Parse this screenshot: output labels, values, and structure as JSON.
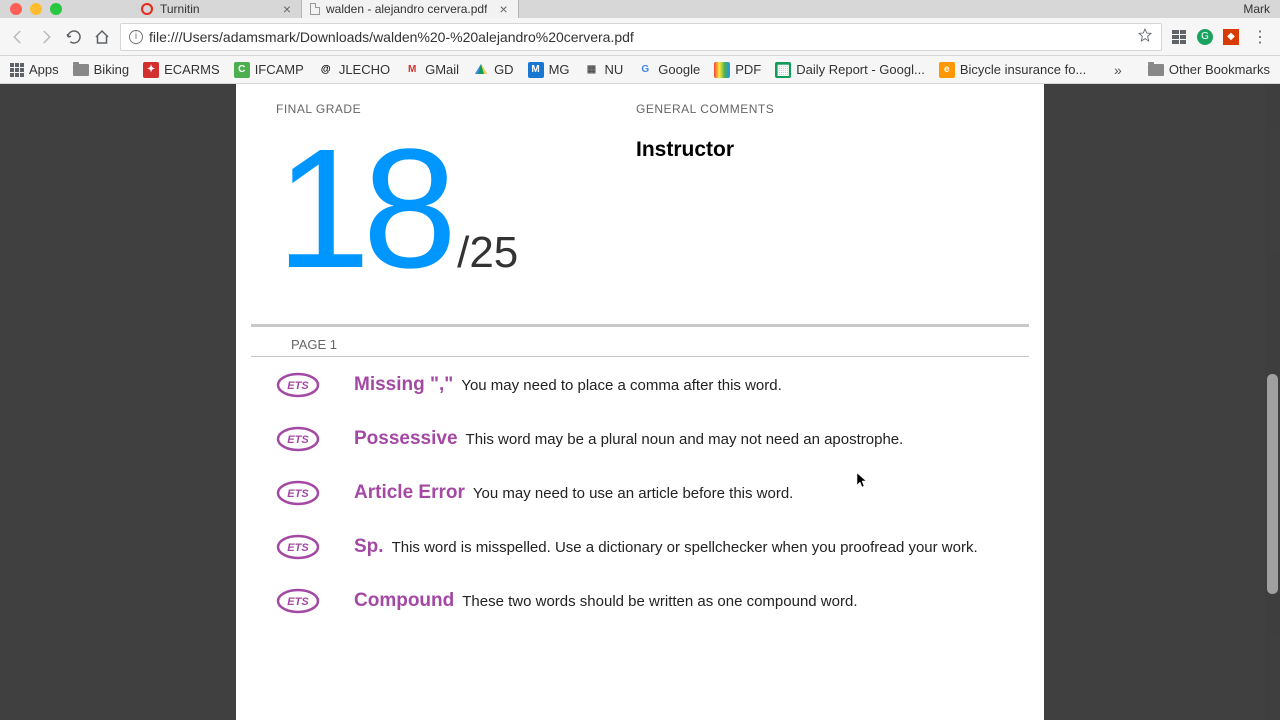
{
  "browser": {
    "profile_name": "Mark",
    "tabs": [
      {
        "label": "Turnitin",
        "active": false
      },
      {
        "label": "walden - alejandro cervera.pdf",
        "active": true
      }
    ],
    "url": "file:///Users/adamsmark/Downloads/walden%20-%20alejandro%20cervera.pdf"
  },
  "bookmarks": {
    "apps_label": "Apps",
    "items": [
      {
        "label": "Biking",
        "icon": "folder"
      },
      {
        "label": "ECARMS",
        "icon": "red"
      },
      {
        "label": "IFCAMP",
        "icon": "green-c"
      },
      {
        "label": "JLECHO",
        "icon": "swirl"
      },
      {
        "label": "GMail",
        "icon": "mail"
      },
      {
        "label": "GD",
        "icon": "drive"
      },
      {
        "label": "MG",
        "icon": "blue-m"
      },
      {
        "label": "NU",
        "icon": "nu"
      },
      {
        "label": "Google",
        "icon": "google"
      },
      {
        "label": "PDF",
        "icon": "pdf"
      },
      {
        "label": "Daily Report - Googl...",
        "icon": "sheets"
      },
      {
        "label": "Bicycle insurance fo...",
        "icon": "orange"
      }
    ],
    "other_label": "Other Bookmarks"
  },
  "document": {
    "final_grade_label": "FINAL GRADE",
    "grade_score": "18",
    "grade_total": "/25",
    "general_comments_label": "GENERAL COMMENTS",
    "instructor_label": "Instructor",
    "page_label": "PAGE 1",
    "feedback": [
      {
        "title": "Missing \",\"",
        "desc": "You may need to place a comma after this word."
      },
      {
        "title": "Possessive",
        "desc": "This word may be a plural noun and may not need an apostrophe."
      },
      {
        "title": "Article Error",
        "desc": "You may need to use an article before this word."
      },
      {
        "title": "Sp.",
        "desc": "This word is misspelled. Use a dictionary or spellchecker when you proofread your work."
      },
      {
        "title": "Compound",
        "desc": "These two words should be written as one compound word."
      }
    ]
  }
}
